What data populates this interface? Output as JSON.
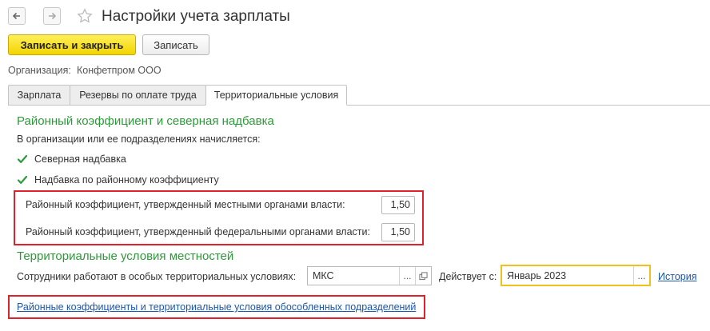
{
  "window": {
    "title": "Настройки учета зарплаты"
  },
  "toolbar": {
    "save_close_label": "Записать и закрыть",
    "save_label": "Записать"
  },
  "organization": {
    "label": "Организация:",
    "value": "Конфетпром ООО"
  },
  "tabs": [
    {
      "label": "Зарплата",
      "active": false
    },
    {
      "label": "Резервы по оплате труда",
      "active": false
    },
    {
      "label": "Территориальные условия",
      "active": true
    }
  ],
  "regional": {
    "title": "Районный коэффициент и северная надбавка",
    "subtitle": "В организации или ее подразделениях начисляется:",
    "checkboxes": [
      {
        "label": "Северная надбавка",
        "checked": true
      },
      {
        "label": "Надбавка по районному коэффициенту",
        "checked": true
      }
    ],
    "local_label": "Районный коэффициент, утвержденный местными органами власти:",
    "local_value": "1,50",
    "federal_label": "Районный коэффициент, утвержденный федеральными органами власти:",
    "federal_value": "1,50"
  },
  "territorial": {
    "title": "Территориальные условия местностей",
    "employees_label": "Сотрудники работают в особых территориальных условиях:",
    "employees_value": "МКС",
    "valid_from_label": "Действует с:",
    "valid_from_value": "Январь 2023",
    "history_link": "История",
    "dots": "..."
  },
  "bottom_link": "Районные коэффициенты и территориальные условия обособленных подразделений",
  "colors": {
    "accent_green": "#2d9a3a",
    "primary_button": "#f3d400",
    "highlight_red": "#e0202a",
    "link_blue": "#1a56b0",
    "focus_yellow": "#f0c020"
  }
}
